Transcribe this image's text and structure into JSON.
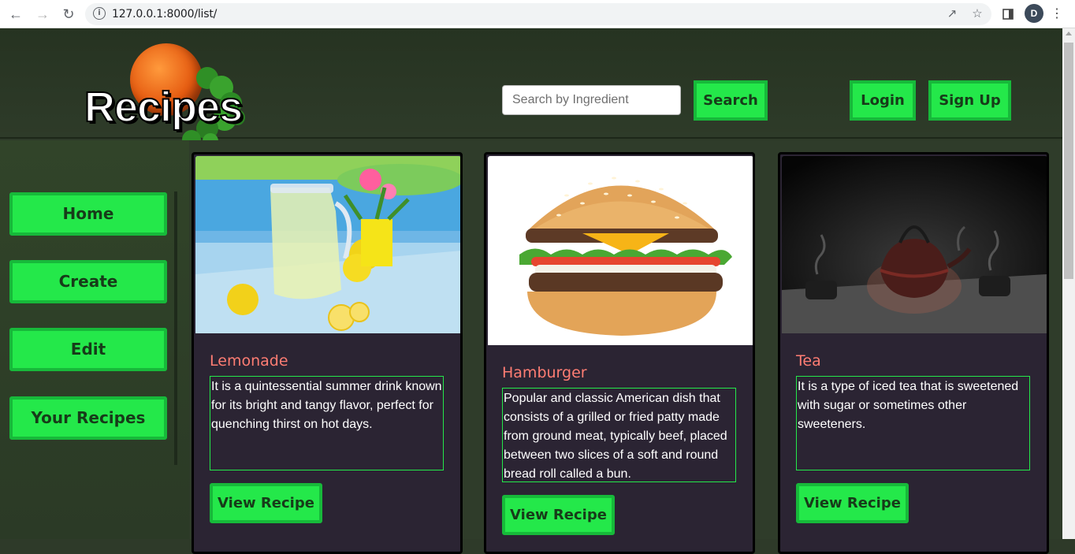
{
  "browser": {
    "url": "127.0.0.1:8000/list/",
    "avatar_letter": "D"
  },
  "header": {
    "logo_text": "Recipes",
    "search_placeholder": "Search by Ingredient",
    "search_label": "Search",
    "login_label": "Login",
    "signup_label": "Sign Up"
  },
  "sidebar": {
    "items": [
      {
        "label": "Home"
      },
      {
        "label": "Create"
      },
      {
        "label": "Edit"
      },
      {
        "label": "Your Recipes"
      }
    ]
  },
  "recipes": [
    {
      "title": "Lemonade",
      "description": "It is a quintessential summer drink known for its bright and tangy flavor, perfect for quenching thirst on hot days.",
      "button": "View Recipe"
    },
    {
      "title": "Hamburger",
      "description": "Popular and classic American dish that consists of a grilled or fried patty made from ground meat, typically beef, placed between two slices of a soft and round bread roll called a bun.",
      "button": "View Recipe"
    },
    {
      "title": "Tea",
      "description": "It is a type of iced tea that is sweetened with sugar or sometimes other sweeteners.",
      "button": "View Recipe"
    }
  ],
  "colors": {
    "accent": "#24e84a",
    "accent_border": "#17b93a",
    "title": "#ff7d73",
    "card_bg": "#2b2433",
    "page_bg": "#2e3a29"
  }
}
